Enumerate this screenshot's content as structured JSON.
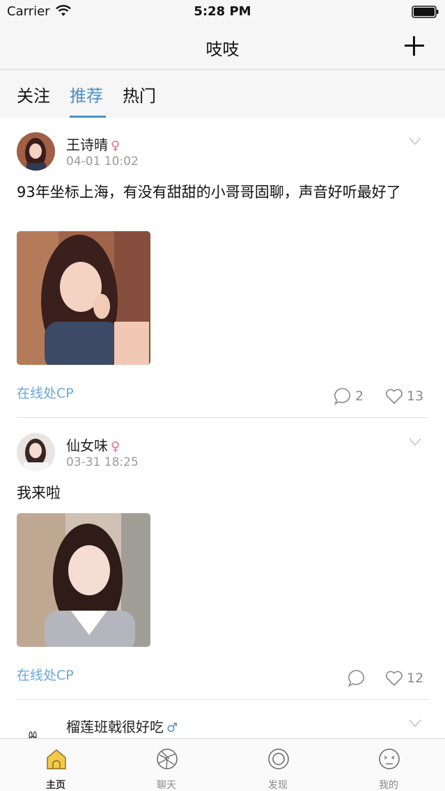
{
  "status_bar": {
    "carrier": "Carrier",
    "time": "5:28 PM"
  },
  "nav": {
    "title": "吱吱"
  },
  "tabs": [
    {
      "label": "关注",
      "active": false
    },
    {
      "label": "推荐",
      "active": true
    },
    {
      "label": "热门",
      "active": false
    }
  ],
  "posts": [
    {
      "username": "王诗晴",
      "gender_symbol": "♀",
      "time": "04-01 10:02",
      "content": "93年坐标上海，有没有甜甜的小哥哥固聊，声音好听最好了",
      "tag": "在线处CP",
      "comments": "2",
      "likes": "13"
    },
    {
      "username": "仙女味",
      "gender_symbol": "♀",
      "time": "03-31 18:25",
      "content": "我来啦",
      "tag": "在线处CP",
      "comments": "",
      "likes": "12"
    },
    {
      "username": "榴莲班戟很好吃",
      "gender_symbol": "♂"
    }
  ],
  "tabbar": [
    {
      "label": "主页",
      "icon": "home-icon",
      "active": true
    },
    {
      "label": "聊天",
      "icon": "aperture-icon",
      "active": false
    },
    {
      "label": "发现",
      "icon": "target-icon",
      "active": false
    },
    {
      "label": "我的",
      "icon": "face-icon",
      "active": false
    }
  ],
  "colors": {
    "accent": "#4a90c8",
    "tag": "#6aa7d6",
    "female": "#e86b8c",
    "male": "#4a90c8",
    "home_icon": "#f2c94c"
  }
}
